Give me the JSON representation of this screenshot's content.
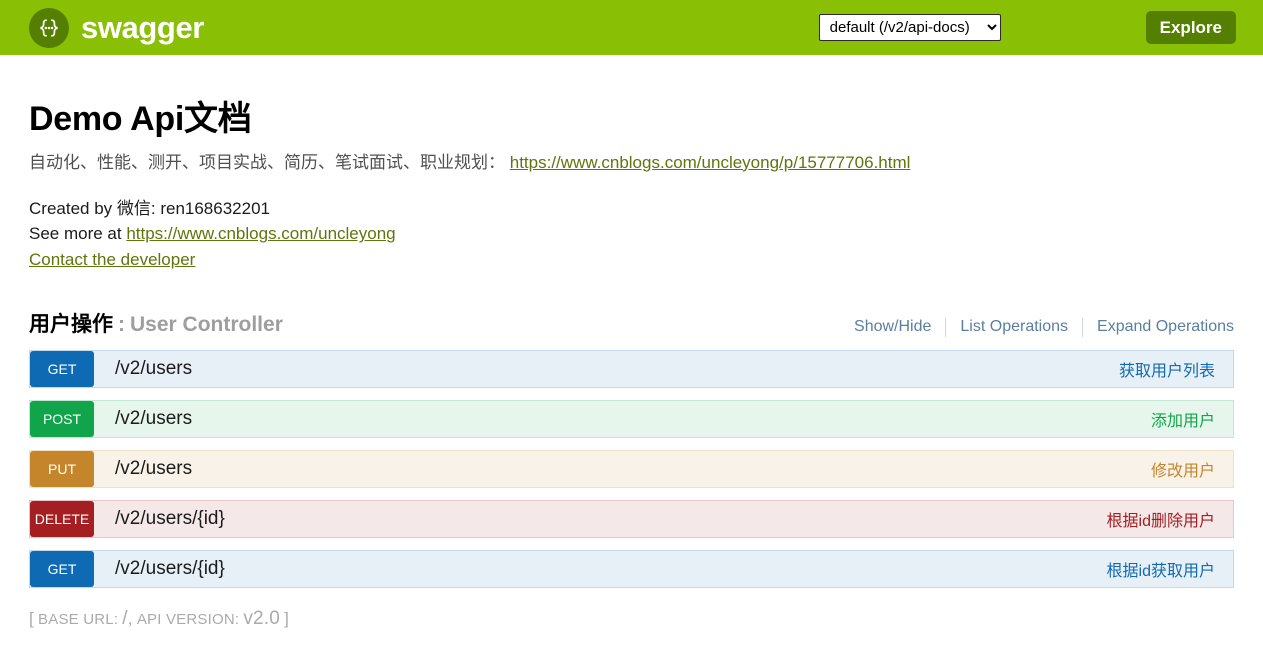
{
  "topbar": {
    "logo_icon": "swagger-braces-icon",
    "logo_text": "swagger",
    "api_select_value": "default (/v2/api-docs)",
    "api_select_options": [
      "default (/v2/api-docs)"
    ],
    "explore_label": "Explore",
    "background_color": "#89bf04",
    "accent_color": "#547f00"
  },
  "info": {
    "title": "Demo Api文档",
    "subtitle_text": "自动化、性能、测开、项目实战、简历、笔试面试、职业规划：",
    "subtitle_link": "https://www.cnblogs.com/uncleyong/p/15777706.html",
    "created_by": "Created by 微信: ren168632201",
    "see_more_prefix": "See more at ",
    "see_more_link": "https://www.cnblogs.com/uncleyong",
    "contact_link": "Contact the developer"
  },
  "resource": {
    "title": "用户操作",
    "separator": ":",
    "subtitle": "User Controller",
    "actions": [
      {
        "label": "Show/Hide"
      },
      {
        "label": "List Operations"
      },
      {
        "label": "Expand Operations"
      }
    ]
  },
  "operations": [
    {
      "method": "GET",
      "path": "/v2/users",
      "description": "获取用户列表",
      "theme": "m-get"
    },
    {
      "method": "POST",
      "path": "/v2/users",
      "description": "添加用户",
      "theme": "m-post"
    },
    {
      "method": "PUT",
      "path": "/v2/users",
      "description": "修改用户",
      "theme": "m-put"
    },
    {
      "method": "DELETE",
      "path": "/v2/users/{id}",
      "description": "根据id删除用户",
      "theme": "m-delete"
    },
    {
      "method": "GET",
      "path": "/v2/users/{id}",
      "description": "根据id获取用户",
      "theme": "m-get"
    }
  ],
  "footer": {
    "open_bracket": "[",
    "base_url_label": "BASE URL:",
    "base_url_value": "/",
    "comma": ",",
    "api_version_label": "API VERSION:",
    "api_version_value": "v2.0",
    "close_bracket": "]"
  }
}
